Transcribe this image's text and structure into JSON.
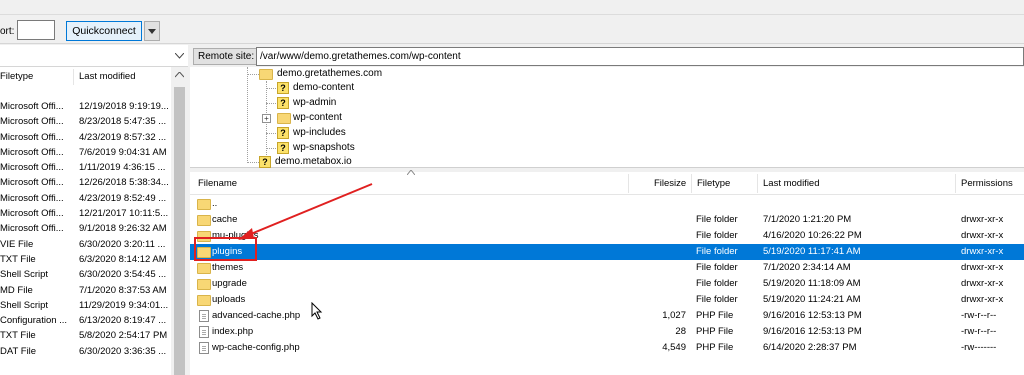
{
  "toolbar": {
    "port_label": "ort:",
    "port_value": "",
    "quickconnect_label": "Quickconnect"
  },
  "local": {
    "columns": [
      "Filetype",
      "Last modified"
    ],
    "rows": [
      {
        "type": "Microsoft Offi...",
        "modified": "12/19/2018 9:19:19..."
      },
      {
        "type": "Microsoft Offi...",
        "modified": "8/23/2018 5:47:35 ..."
      },
      {
        "type": "Microsoft Offi...",
        "modified": "4/23/2019 8:57:32 ..."
      },
      {
        "type": "Microsoft Offi...",
        "modified": "7/6/2019 9:04:31 AM"
      },
      {
        "type": "Microsoft Offi...",
        "modified": "1/11/2019 4:36:15 ..."
      },
      {
        "type": "Microsoft Offi...",
        "modified": "12/26/2018 5:38:34..."
      },
      {
        "type": "Microsoft Offi...",
        "modified": "4/23/2019 8:52:49 ..."
      },
      {
        "type": "Microsoft Offi...",
        "modified": "12/21/2017 10:11:5..."
      },
      {
        "type": "Microsoft Offi...",
        "modified": "9/1/2018 9:26:32 AM"
      },
      {
        "type": "VIE File",
        "modified": "6/30/2020 3:20:11 ..."
      },
      {
        "type": "TXT File",
        "modified": "6/3/2020 8:14:12 AM"
      },
      {
        "type": "Shell Script",
        "modified": "6/30/2020 3:54:45 ..."
      },
      {
        "type": "MD File",
        "modified": "7/1/2020 8:37:53 AM"
      },
      {
        "type": "Shell Script",
        "modified": "11/29/2019 9:34:01..."
      },
      {
        "type": "Configuration ...",
        "modified": "6/13/2020 8:19:47 ..."
      },
      {
        "type": "TXT File",
        "modified": "5/8/2020 2:54:17 PM"
      },
      {
        "type": "DAT File",
        "modified": "6/30/2020 3:36:35 ..."
      }
    ]
  },
  "remote": {
    "site_label": "Remote site:",
    "path": "/var/www/demo.gretathemes.com/wp-content",
    "tree": [
      {
        "label": "demo.gretathemes.com",
        "icon": "folder-icon"
      },
      {
        "label": "demo-content",
        "icon": "unknown-folder-icon"
      },
      {
        "label": "wp-admin",
        "icon": "unknown-folder-icon"
      },
      {
        "label": "wp-content",
        "icon": "folder-icon"
      },
      {
        "label": "wp-includes",
        "icon": "unknown-folder-icon"
      },
      {
        "label": "wp-snapshots",
        "icon": "unknown-folder-icon"
      },
      {
        "label": "demo.metabox.io",
        "icon": "unknown-folder-icon"
      }
    ],
    "columns": {
      "filename": "Filename",
      "filesize": "Filesize",
      "filetype": "Filetype",
      "modified": "Last modified",
      "permissions": "Permissions"
    },
    "files": [
      {
        "name": "..",
        "size": "",
        "type": "",
        "modified": "",
        "perm": "",
        "icon": "folder"
      },
      {
        "name": "cache",
        "size": "",
        "type": "File folder",
        "modified": "7/1/2020 1:21:20 PM",
        "perm": "drwxr-xr-x",
        "icon": "folder"
      },
      {
        "name": "mu-plugins",
        "size": "",
        "type": "File folder",
        "modified": "4/16/2020 10:26:22 PM",
        "perm": "drwxr-xr-x",
        "icon": "folder"
      },
      {
        "name": "plugins",
        "size": "",
        "type": "File folder",
        "modified": "5/19/2020 11:17:41 AM",
        "perm": "drwxr-xr-x",
        "icon": "folder",
        "selected": true
      },
      {
        "name": "themes",
        "size": "",
        "type": "File folder",
        "modified": "7/1/2020 2:34:14 AM",
        "perm": "drwxr-xr-x",
        "icon": "folder"
      },
      {
        "name": "upgrade",
        "size": "",
        "type": "File folder",
        "modified": "5/19/2020 11:18:09 AM",
        "perm": "drwxr-xr-x",
        "icon": "folder"
      },
      {
        "name": "uploads",
        "size": "",
        "type": "File folder",
        "modified": "5/19/2020 11:24:21 AM",
        "perm": "drwxr-xr-x",
        "icon": "folder"
      },
      {
        "name": "advanced-cache.php",
        "size": "1,027",
        "type": "PHP File",
        "modified": "9/16/2016 12:53:13 PM",
        "perm": "-rw-r--r--",
        "icon": "file"
      },
      {
        "name": "index.php",
        "size": "28",
        "type": "PHP File",
        "modified": "9/16/2016 12:53:13 PM",
        "perm": "-rw-r--r--",
        "icon": "file"
      },
      {
        "name": "wp-cache-config.php",
        "size": "4,549",
        "type": "PHP File",
        "modified": "6/14/2020 2:28:37 PM",
        "perm": "-rw-------",
        "icon": "file"
      }
    ]
  },
  "colors": {
    "selection": "#0078d7",
    "annotation": "#e02020",
    "folder": "#f8d775"
  }
}
